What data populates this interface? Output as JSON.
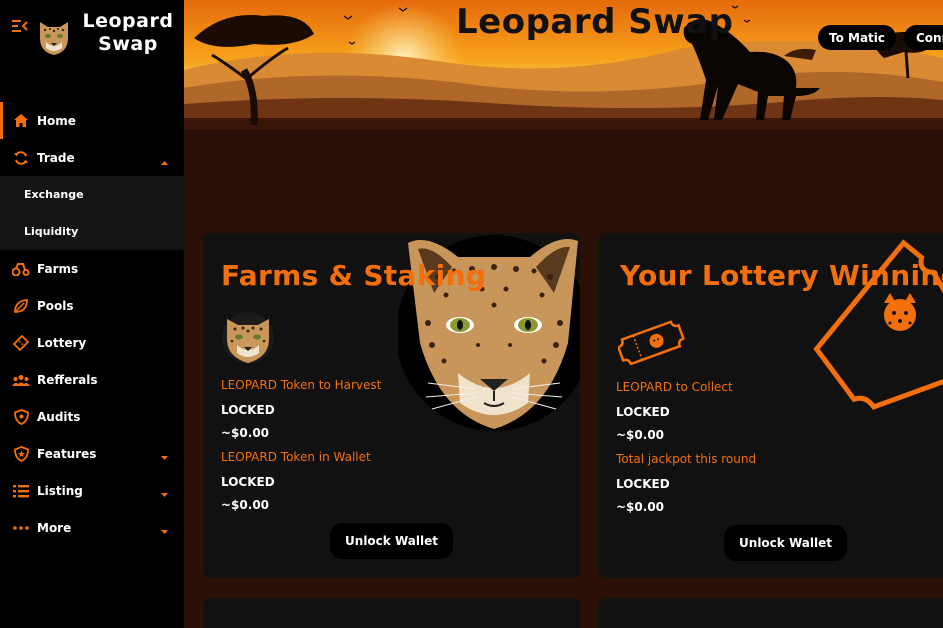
{
  "brand": {
    "name_line1": "Leopard",
    "name_line2": "Swap"
  },
  "sidebar": {
    "items": [
      {
        "label": "Home",
        "icon": "home-icon"
      },
      {
        "label": "Trade",
        "icon": "trade-icon"
      },
      {
        "label": "Farms",
        "icon": "farms-icon"
      },
      {
        "label": "Pools",
        "icon": "pools-icon"
      },
      {
        "label": "Lottery",
        "icon": "lottery-icon"
      },
      {
        "label": "Refferals",
        "icon": "referrals-icon"
      },
      {
        "label": "Audits",
        "icon": "audits-icon"
      },
      {
        "label": "Features",
        "icon": "features-icon"
      },
      {
        "label": "Listing",
        "icon": "listing-icon"
      },
      {
        "label": "More",
        "icon": "more-icon"
      }
    ],
    "trade_sub": [
      {
        "label": "Exchange"
      },
      {
        "label": "Liquidity"
      }
    ]
  },
  "header": {
    "title": "Leopard Swap",
    "matic_button": "To Matic",
    "connect_button": "Connect"
  },
  "farms_card": {
    "title": "Farms & Staking",
    "harvest_label": "LEOPARD Token to Harvest",
    "harvest_value": "LOCKED",
    "harvest_usd": "~$0.00",
    "wallet_label": "LEOPARD Token in Wallet",
    "wallet_value": "LOCKED",
    "wallet_usd": "~$0.00",
    "unlock_button": "Unlock Wallet"
  },
  "lottery_card": {
    "title": "Your Lottery Winnings",
    "collect_label": "LEOPARD to Collect",
    "collect_value": "LOCKED",
    "collect_usd": "~$0.00",
    "jackpot_label": "Total jackpot this round",
    "jackpot_value": "LOCKED",
    "jackpot_usd": "~$0.00",
    "unlock_button": "Unlock Wallet"
  },
  "colors": {
    "accent": "#f26f0c",
    "sidebar_bg": "#000000",
    "page_bg": "#2a0f06",
    "card_bg": "#111111"
  }
}
